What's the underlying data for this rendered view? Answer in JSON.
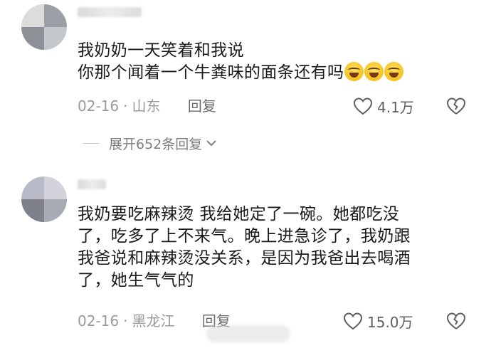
{
  "comments": [
    {
      "text_lines": [
        "我奶奶一天笑着和我说",
        "你那个闻着一个牛粪味的面条还有吗"
      ],
      "emoji_name": "laughing-tears-emoji",
      "date": "02-16",
      "location": "山东",
      "reply_label": "回复",
      "likes": "4.1万",
      "expand_replies_label": "展开652条回复"
    },
    {
      "text_lines": [
        "我奶要吃麻辣烫 我给她定了一碗。她都吃没",
        "了，吃多了上不来气。晚上进急诊了，我奶跟",
        "我爸说和麻辣烫没关系，是因为我爸出去喝酒",
        "了，她生气气的"
      ],
      "date": "02-16",
      "location": "黑龙江",
      "reply_label": "回复",
      "likes": "15.0万"
    }
  ],
  "icons": {
    "like": "heart-outline-icon",
    "dislike": "broken-heart-icon",
    "expand": "chevron-down-icon"
  },
  "colors": {
    "text": "#1a1a1a",
    "meta": "#9a9a9a",
    "icon": "#5f5f5f"
  }
}
